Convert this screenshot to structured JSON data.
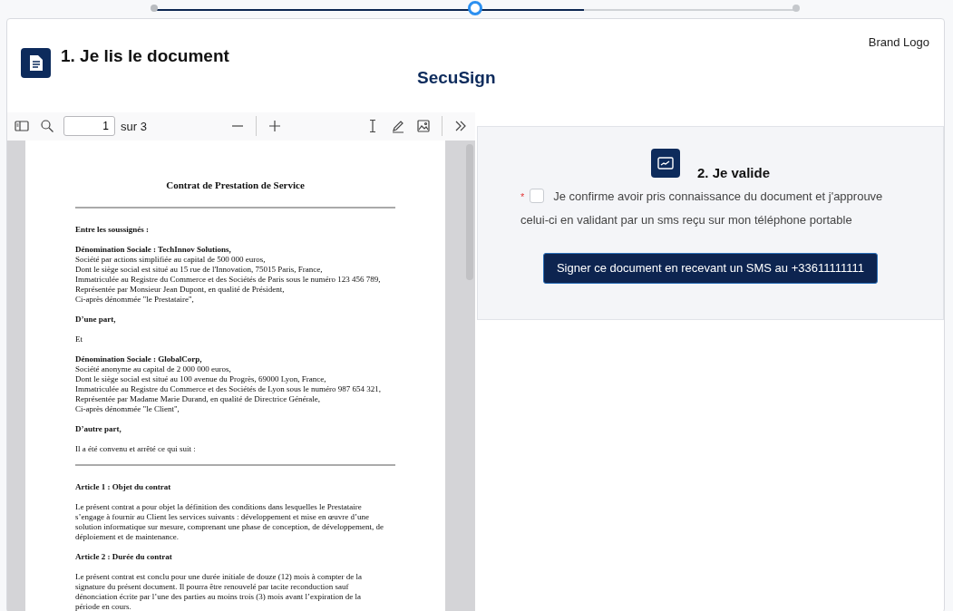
{
  "stepper": {
    "level": 0.67,
    "steps": [
      {
        "done": true,
        "selected": false
      },
      {
        "done": false,
        "selected": true
      },
      {
        "done": false,
        "selected": false
      }
    ]
  },
  "header": {
    "title": "1. Je lis le document",
    "app_name": "SecuSign",
    "brand": "Brand Logo"
  },
  "viewer": {
    "toolbar": {
      "page": "1",
      "page_count": "sur 3"
    },
    "document": [
      {
        "kind": "title",
        "text": "Contrat de Prestation de Service"
      },
      {
        "kind": "rule"
      },
      {
        "kind": "heading",
        "text": "Entre les soussignés :"
      },
      {
        "kind": "party",
        "heading": "Dénomination Sociale : TechInnov Solutions,",
        "lines": [
          "Société par actions simplifiée au capital de 500 000 euros,",
          "Dont le siège social est situé au 15 rue de l'Innovation, 75015 Paris, France,",
          "Immatriculée au Registre du Commerce et des Sociétés de Paris sous le numéro 123 456 789,",
          "Représentée par Monsieur Jean Dupont, en qualité de Président,",
          "Ci-après dénommée \"le Prestataire\","
        ]
      },
      {
        "kind": "heading",
        "text": "D’une part,"
      },
      {
        "kind": "paragraph",
        "lines": [
          "Et"
        ]
      },
      {
        "kind": "party",
        "heading": "Dénomination Sociale : GlobalCorp,",
        "lines": [
          "Société anonyme au capital de 2 000 000 euros,",
          "Dont le siège social est situé au 100 avenue du Progrès, 69000 Lyon, France,",
          "Immatriculée au Registre du Commerce et des Sociétés de Lyon sous le numéro 987 654 321,",
          "Représentée par Madame Marie Durand, en qualité de Directrice Générale,",
          "Ci-après dénommée \"le Client\","
        ]
      },
      {
        "kind": "heading",
        "text": "D’autre part,"
      },
      {
        "kind": "paragraph",
        "lines": [
          "Il a été convenu et arrêté ce qui suit :"
        ]
      },
      {
        "kind": "rule"
      },
      {
        "kind": "heading",
        "text": "Article 1 : Objet du contrat"
      },
      {
        "kind": "paragraph",
        "lines": [
          "Le présent contrat a pour objet la définition des conditions dans lesquelles le Prestataire",
          "s’engage à fournir au Client les services suivants : développement et mise en œuvre d’une",
          "solution informatique sur mesure, comprenant une phase de conception, de développement, de",
          "déploiement et de maintenance."
        ]
      },
      {
        "kind": "heading",
        "text": "Article 2 : Durée du contrat"
      },
      {
        "kind": "paragraph",
        "lines": [
          "Le présent contrat est conclu pour une durée initiale de douze (12) mois à compter de la",
          "signature du présent document. Il pourra être renouvelé par tacite reconduction sauf",
          "dénonciation écrite par l’une des parties au moins trois (3) mois avant l’expiration de la",
          "période en cours."
        ]
      }
    ]
  },
  "validation": {
    "title": "2. Je valide",
    "required_mark": "*",
    "checked": false,
    "consent_lines": [
      "Je confirme avoir pris connaissance du document et j'approuve",
      "celui-ci en validant par un sms reçu sur mon téléphone portable"
    ],
    "button": "Signer ce document en recevant un SMS au +33611111111"
  }
}
